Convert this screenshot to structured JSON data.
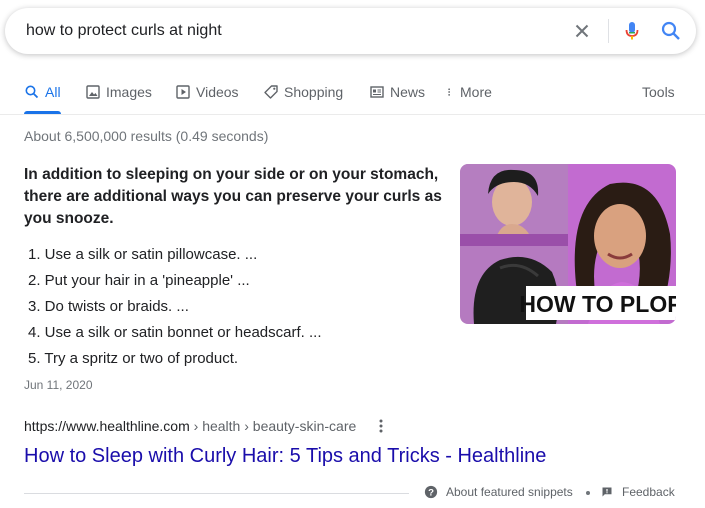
{
  "search": {
    "query": "how to protect curls at night"
  },
  "tabs": [
    {
      "label": "All",
      "icon": "search-icon",
      "active": true
    },
    {
      "label": "Images",
      "icon": "image-icon"
    },
    {
      "label": "Videos",
      "icon": "video-icon"
    },
    {
      "label": "Shopping",
      "icon": "tag-icon"
    },
    {
      "label": "News",
      "icon": "newspaper-icon"
    },
    {
      "label": "More",
      "icon": "dots-vertical-icon"
    }
  ],
  "tools_label": "Tools",
  "result_stats": "About 6,500,000 results (0.49 seconds)",
  "featured_snippet": {
    "heading": "In addition to sleeping on your side or on your stomach, there are additional ways you can preserve your curls as you snooze.",
    "items": [
      "1. Use a silk or satin pillowcase. ...",
      "2. Put your hair in a 'pineapple' ...",
      "3. Do twists or braids. ...",
      "4. Use a silk or satin bonnet or headscarf. ...",
      "5. Try a spritz or two of product."
    ],
    "date": "Jun 11, 2020",
    "thumbnail_caption": "HOW TO PLOP"
  },
  "result": {
    "url_base": "https://www.healthline.com",
    "url_path": " › health › beauty-skin-care",
    "title": "How to Sleep with Curly Hair: 5 Tips and Tricks - Healthline"
  },
  "footer": {
    "about_label": "About featured snippets",
    "feedback_label": "Feedback"
  },
  "colors": {
    "accent": "#1a73e8",
    "link": "#1a0dab",
    "mic_blue": "#4285f4",
    "mic_red": "#ea4335",
    "mic_yellow": "#fbbc04",
    "mic_green": "#34a853"
  }
}
